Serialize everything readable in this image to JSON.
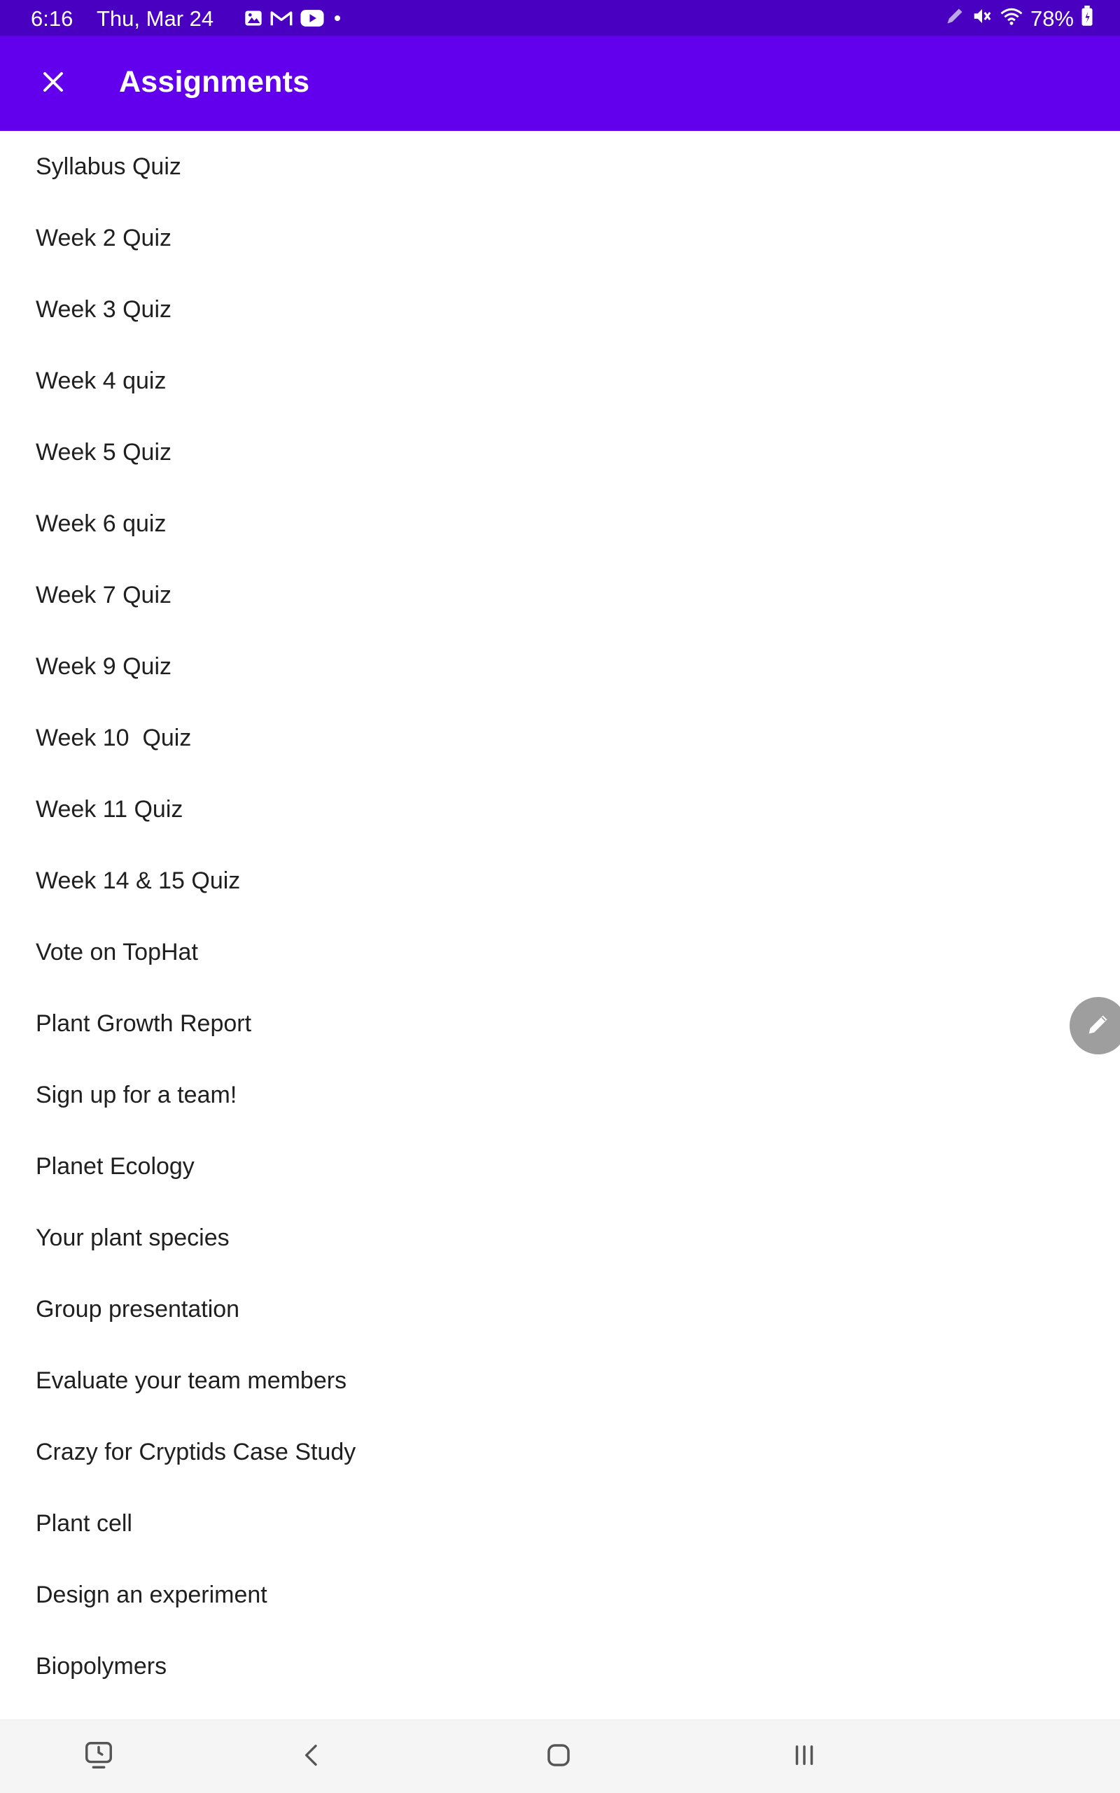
{
  "status_bar": {
    "time": "6:16",
    "date": "Thu, Mar 24",
    "battery": "78%",
    "notification_icons": [
      "gallery-icon",
      "gmail-icon",
      "youtube-icon",
      "dot-icon"
    ],
    "system_icons": [
      "pen-icon",
      "mute-icon",
      "wifi-icon",
      "battery-icon"
    ]
  },
  "app_bar": {
    "title": "Assignments",
    "close_icon": "close-icon",
    "background": "#6200ee"
  },
  "assignments": [
    "Syllabus Quiz",
    "Week 2 Quiz",
    "Week 3 Quiz",
    "Week 4 quiz",
    "Week 5 Quiz",
    "Week 6 quiz",
    "Week 7 Quiz",
    "Week 9 Quiz",
    "Week 10  Quiz",
    "Week 11 Quiz",
    "Week 14 & 15 Quiz",
    "Vote on TopHat",
    "Plant Growth Report",
    "Sign up for a team!",
    "Planet Ecology",
    "Your plant species",
    "Group presentation",
    "Evaluate your team members",
    "Crazy for Cryptids Case Study",
    "Plant cell",
    "Design an experiment",
    "Biopolymers"
  ],
  "floating_button": {
    "icon": "pencil-icon"
  },
  "nav_bar": {
    "icons": [
      "screen-recorder-icon",
      "back-icon",
      "home-icon",
      "recents-icon"
    ]
  }
}
